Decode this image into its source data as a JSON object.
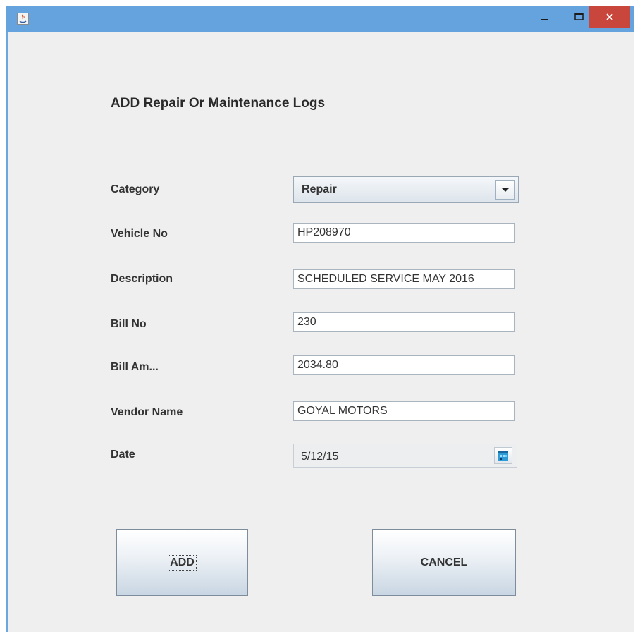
{
  "window": {
    "title": "",
    "controls": [
      "minimize-icon",
      "maximize-icon",
      "close-icon"
    ]
  },
  "form": {
    "heading": "ADD Repair Or Maintenance Logs",
    "category": {
      "label": "Category",
      "value": "Repair"
    },
    "vehicle_no": {
      "label": "Vehicle No",
      "value": "HP208970"
    },
    "description": {
      "label": "Description",
      "value": "SCHEDULED SERVICE MAY 2016"
    },
    "bill_no": {
      "label": "Bill No",
      "value": "230"
    },
    "bill_amount": {
      "label": "Bill Am...",
      "value": "2034.80"
    },
    "vendor_name": {
      "label": "Vendor Name",
      "value": "GOYAL MOTORS"
    },
    "date": {
      "label": "Date",
      "value": "5/12/15"
    }
  },
  "buttons": {
    "add": "ADD",
    "cancel": "CANCEL"
  },
  "colors": {
    "titlebar": "#64a3dd",
    "close_button": "#c9463d",
    "panel": "#efefef"
  }
}
